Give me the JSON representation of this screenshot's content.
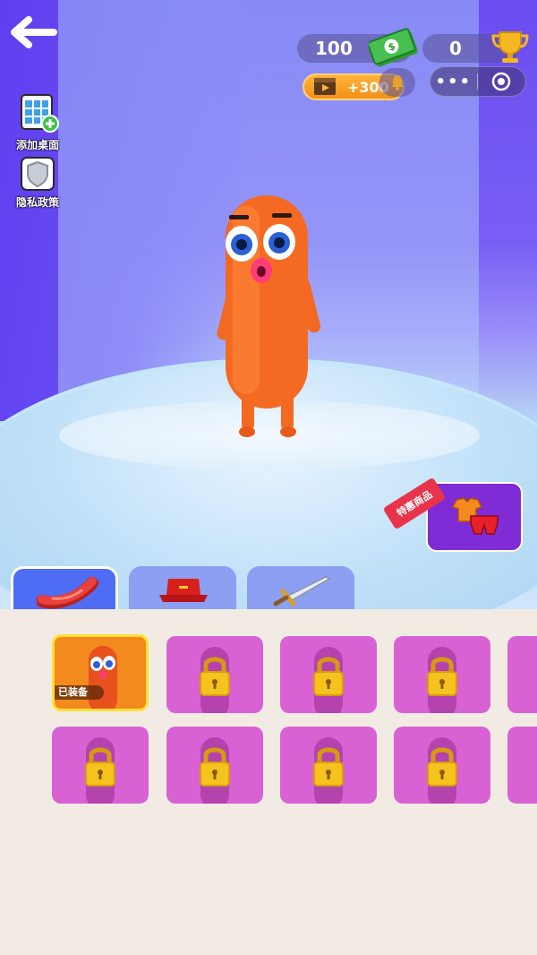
{
  "header": {
    "cash_value": "100",
    "trophy_value": "0",
    "bonus_label": "+300"
  },
  "side_buttons": {
    "add_desktop": "添加桌面",
    "privacy": "隐私政策"
  },
  "special_offer": {
    "tag_label": "特惠商品"
  },
  "tabs": [
    {
      "name": "character",
      "icon": "sausage-icon",
      "active": true
    },
    {
      "name": "hat",
      "icon": "hat-icon",
      "active": false
    },
    {
      "name": "weapon",
      "icon": "sword-icon",
      "active": false
    }
  ],
  "skins": {
    "equipped_label": "已装备",
    "row1": [
      "equipped",
      "locked",
      "locked",
      "locked",
      "locked"
    ],
    "row2": [
      "locked",
      "locked",
      "locked",
      "locked",
      "locked"
    ]
  },
  "colors": {
    "stage_purple": "#6a4cf0",
    "tab_active": "#4f6cf5",
    "tile_locked": "#d862d4",
    "tile_selected": "#f28a1e",
    "panel_bg": "#f2ebe4"
  }
}
